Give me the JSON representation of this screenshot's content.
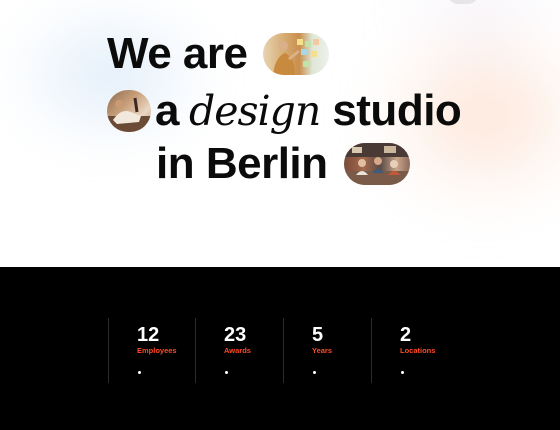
{
  "hero": {
    "line1": {
      "text": "We are"
    },
    "line2": {
      "prefix": "a",
      "serif_word": "design",
      "suffix": "studio"
    },
    "line3": {
      "text": "in Berlin"
    },
    "images": [
      "photo-woman-at-sticky-note-board",
      "photo-person-relaxing-on-sofa",
      "photo-team-in-office"
    ]
  },
  "stats": [
    {
      "value": "12",
      "label": "Employees"
    },
    {
      "value": "23",
      "label": "Awards"
    },
    {
      "value": "5",
      "label": "Years"
    },
    {
      "value": "2",
      "label": "Locations"
    }
  ],
  "colors": {
    "accent": "#ff4a26",
    "heading": "#0b0b0b",
    "stats_background": "#000000",
    "stats_value": "#ffffff"
  }
}
